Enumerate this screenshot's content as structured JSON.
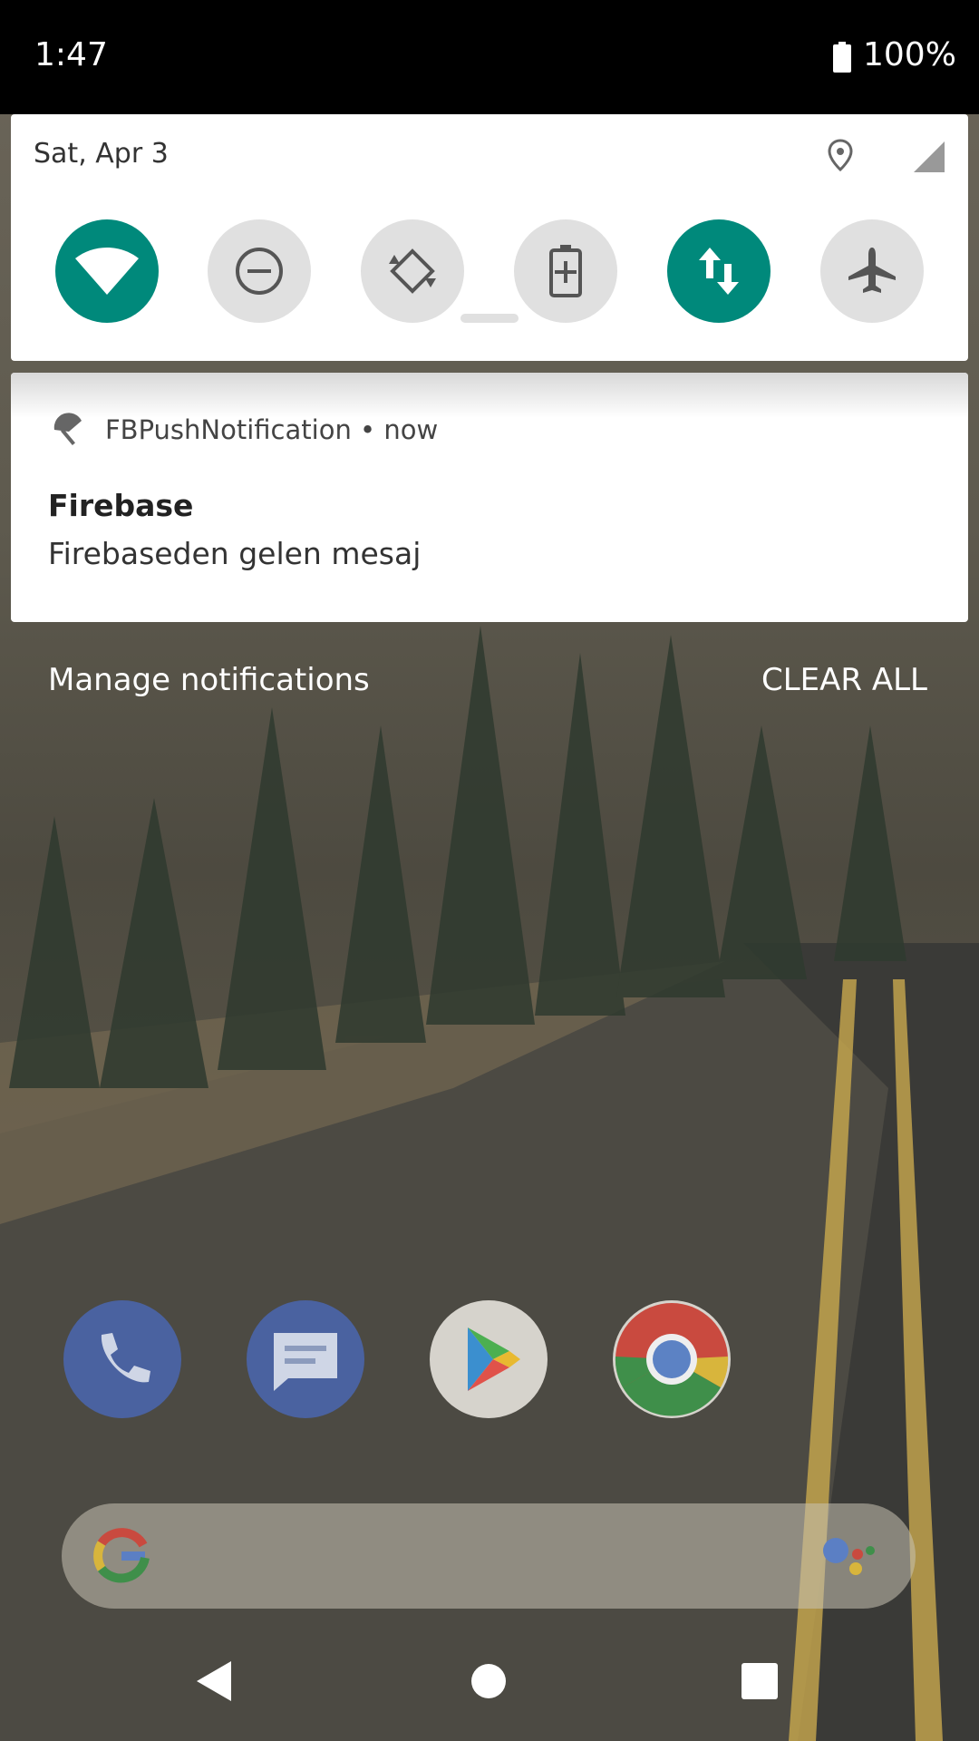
{
  "status_bar": {
    "time": "1:47",
    "battery": "100%"
  },
  "quick_settings": {
    "date": "Sat, Apr 3",
    "tiles": [
      {
        "name": "wifi",
        "state": "on"
      },
      {
        "name": "do-not-disturb",
        "state": "off"
      },
      {
        "name": "auto-rotate",
        "state": "off"
      },
      {
        "name": "battery-saver",
        "state": "off"
      },
      {
        "name": "mobile-data",
        "state": "on"
      },
      {
        "name": "airplane-mode",
        "state": "off"
      }
    ]
  },
  "notification": {
    "app_name": "FBPushNotification",
    "time": "now",
    "header_text": "FBPushNotification • now",
    "title": "Firebase",
    "body": "Firebaseden gelen mesaj"
  },
  "actions": {
    "manage": "Manage notifications",
    "clear_all": "CLEAR ALL"
  },
  "dock": [
    "phone-icon",
    "messages-icon",
    "play-store-icon",
    "chrome-icon"
  ],
  "colors": {
    "accent": "#00897b",
    "tile_off": "#e0e0e0"
  }
}
